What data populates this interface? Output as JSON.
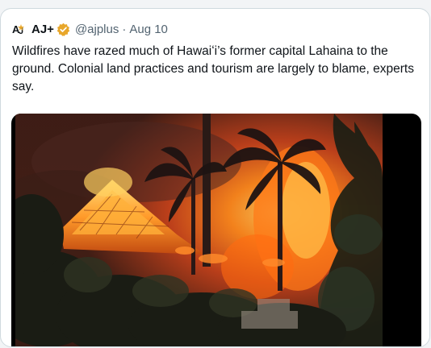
{
  "tweet": {
    "author": {
      "avatar_icon": "aj-plus-logo-icon",
      "display_name": "AJ+",
      "verified_icon": "verified-badge-icon",
      "verified_color": "#e8a72b",
      "handle": "@ajplus",
      "separator": "·",
      "date": "Aug 10"
    },
    "text": "Wildfires have razed much of Hawaiʻi’s former capital Lahaina to the ground. Colonial land practices and tourism are largely to blame, experts say.",
    "media": {
      "type": "photo",
      "alt": "Fire burning buildings and palm trees in Lahaina"
    }
  }
}
